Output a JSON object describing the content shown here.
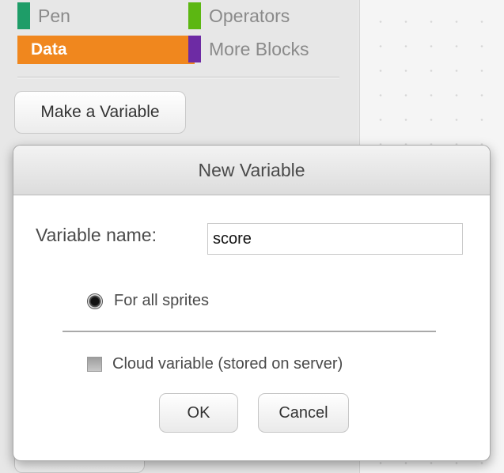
{
  "palette": {
    "categories": {
      "pen": {
        "label": "Pen",
        "color": "#1e9d68"
      },
      "operators": {
        "label": "Operators",
        "color": "#5cb712"
      },
      "data": {
        "label": "Data",
        "color": "#f0871e"
      },
      "more_blocks": {
        "label": "More Blocks",
        "color": "#6d2ba4"
      }
    },
    "make_variable_label": "Make a Variable"
  },
  "dialog": {
    "title": "New Variable",
    "name_label": "Variable name:",
    "name_value": "score",
    "scope_option_label": "For all sprites",
    "scope_selected": true,
    "cloud_label": "Cloud variable (stored on server)",
    "cloud_checked": false,
    "ok_label": "OK",
    "cancel_label": "Cancel"
  }
}
